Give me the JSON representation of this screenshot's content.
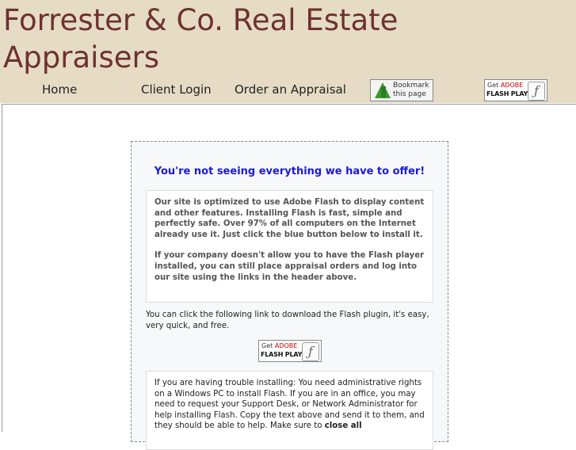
{
  "header": {
    "title": " Forrester & Co. Real Estate Appraisers",
    "nav": {
      "home": "Home",
      "login": "Client Login",
      "order": "Order an Appraisal"
    },
    "bookmark_label_1": "Bookmark",
    "bookmark_label_2": "this page",
    "bookmark_icon": "bookmark-arrow-icon"
  },
  "flash_badge": {
    "get": "Get",
    "adobe": "ADOBE",
    "player": "FLASH PLAYER",
    "icon": "flash-f-icon"
  },
  "notice": {
    "title": "You're not seeing everything we have to offer!",
    "para1": "Our site is optimized to use Adobe Flash to display content and other features. Installing Flash is fast, simple and perfectly safe. Over 97% of all computers on the Internet already use it. Just click the blue button below to install it.",
    "para2": "If your company doesn't allow you to have the Flash player installed, you can still place appraisal orders and log into our site using the links in the header above.",
    "download_text": "You can click the following link to download the Flash plugin, it's easy, very quick, and free.",
    "trouble_text": "If you are having trouble installing: You need administrative rights on a Windows PC to install Flash. If you are in an office, you may need to request your Support Desk, or Network Administrator for help installing Flash. Copy the text above and send it to them, and they should be able to help. Make sure to",
    "trouble_bold": "close all"
  },
  "colors": {
    "header_bg": "#e6dcc5",
    "title_color": "#6e3131",
    "notice_title_color": "#1b1bd6"
  }
}
